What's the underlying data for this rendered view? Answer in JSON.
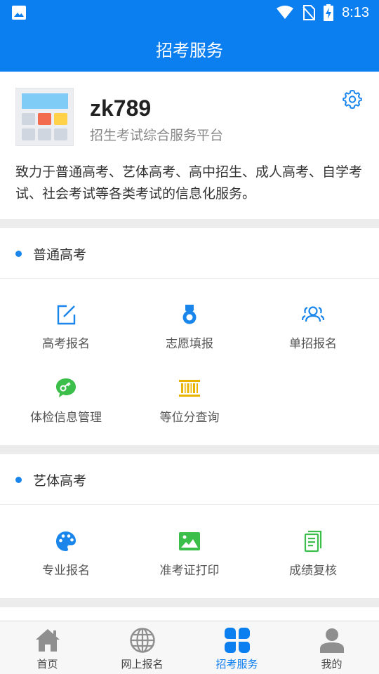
{
  "status_bar": {
    "time": "8:13"
  },
  "app_bar": {
    "title": "招考服务"
  },
  "profile": {
    "name": "zk789",
    "subtitle": "招生考试综合服务平台",
    "description": "致力于普通高考、艺体高考、高中招生、成人高考、自学考试、社会考试等各类考试的信息化服务。"
  },
  "sections": [
    {
      "title": "普通高考",
      "items": [
        {
          "label": "高考报名",
          "icon": "edit-icon",
          "color": "#1a86ec"
        },
        {
          "label": "志愿填报",
          "icon": "medal-icon",
          "color": "#1a86ec"
        },
        {
          "label": "单招报名",
          "icon": "users-icon",
          "color": "#1a86ec"
        },
        {
          "label": "体检信息管理",
          "icon": "key-chat-icon",
          "color": "#3cbf4a"
        },
        {
          "label": "等位分查询",
          "icon": "barcode-icon",
          "color": "#e8b400"
        }
      ]
    },
    {
      "title": "艺体高考",
      "items": [
        {
          "label": "专业报名",
          "icon": "palette-icon",
          "color": "#1a86ec"
        },
        {
          "label": "准考证打印",
          "icon": "image-icon",
          "color": "#3cbf4a"
        },
        {
          "label": "成绩复核",
          "icon": "document-icon",
          "color": "#3cbf4a"
        }
      ]
    }
  ],
  "tab_bar": {
    "items": [
      {
        "label": "首页",
        "icon": "home-icon"
      },
      {
        "label": "网上报名",
        "icon": "globe-icon"
      },
      {
        "label": "招考服务",
        "icon": "service-icon",
        "active": true
      },
      {
        "label": "我的",
        "icon": "user-icon"
      }
    ]
  },
  "colors": {
    "primary": "#0b7ef0",
    "green": "#3cbf4a",
    "yellow": "#e8b400"
  }
}
